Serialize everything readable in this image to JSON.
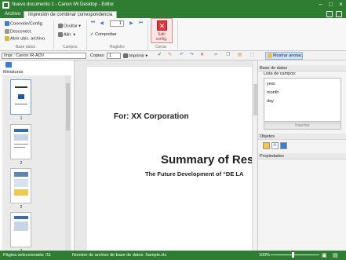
{
  "window": {
    "title": "Nuevo documento 1 - Canon iW Desktop - Editor",
    "min_glyph": "–",
    "max_glyph": "□",
    "close_glyph": "×"
  },
  "tabs": {
    "file": "Archivo",
    "active": "Impresión de combinar correspondencia"
  },
  "ribbon": {
    "base_datos": {
      "items": [
        "Conexión/Config.",
        "Desconect.",
        "Abrir ubic. archivo"
      ],
      "label": "Base datos"
    },
    "campos": {
      "items": [
        "Ocultar",
        "Alin."
      ],
      "label": "Campos"
    },
    "registro": {
      "page_value": "1",
      "check_label": "Comprobar",
      "label": "Registro"
    },
    "cerrar": {
      "exit_label_1": "Salir",
      "exit_label_2": "config.",
      "label": "Cerrar"
    }
  },
  "toolbar": {
    "printer": "Impr.: Canon iR-ADV",
    "copies_label": "Copias:",
    "copies_value": "1",
    "print_label": "Imprimir",
    "show_annotations": "Mostrar anotac."
  },
  "left_panel": {
    "title": "Miniaturas",
    "pages": [
      "1",
      "2",
      "2",
      "2"
    ]
  },
  "document": {
    "for_line": "For: XX Corporation",
    "summary": "Summary of Res",
    "subtitle": "The Future Development of “DE LA"
  },
  "right_panel": {
    "header": "Base de datos",
    "fields_label": "Lista de campos:",
    "fields": [
      "year",
      "month",
      "day"
    ],
    "insert_button": "Insertar",
    "objects_header": "Objetos",
    "properties_header": "Propiedades"
  },
  "status": {
    "selected": "Página seleccionada: /11",
    "db_file": "Nombre de archivo de base de datos: Sample.xls",
    "zoom": "100%"
  },
  "colors": {
    "brand": "#2e7d32",
    "exit": "#e0353a",
    "accent": "#3b7bd0"
  }
}
